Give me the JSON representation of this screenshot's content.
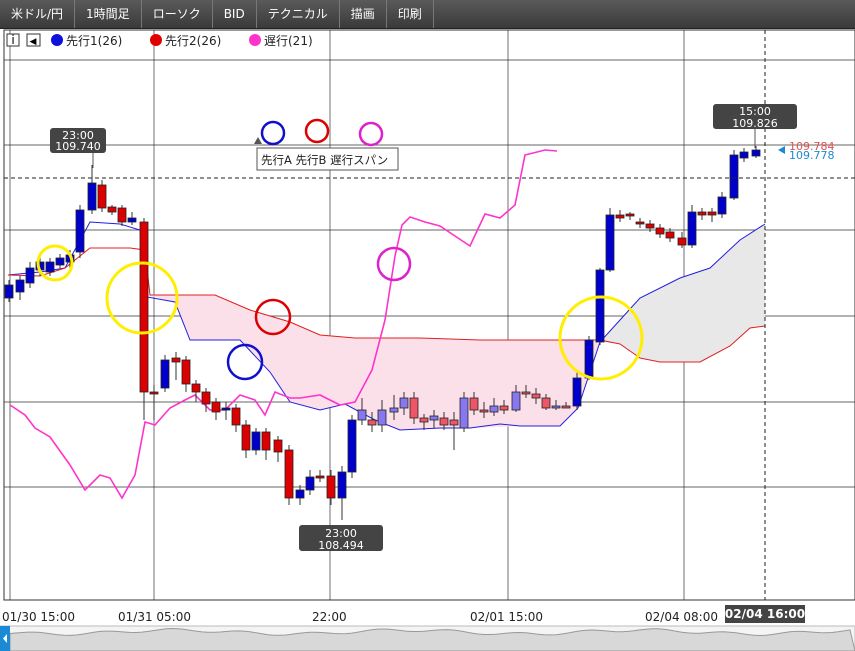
{
  "toolbar": {
    "items": [
      "米ドル/円",
      "1時間足",
      "ローソク",
      "BID",
      "テクニカル",
      "描画",
      "印刷"
    ]
  },
  "legend": {
    "info_icon": "i",
    "collapse_icon": "◀",
    "items": [
      {
        "label": "先行1(26)",
        "color": "#1010dd"
      },
      {
        "label": "先行2(26)",
        "color": "#e00000"
      },
      {
        "label": "遅行(21)",
        "color": "#ff33cc"
      }
    ]
  },
  "annotation": {
    "label": "先行A 先行B 遅行スパン",
    "circle_colors": [
      "#1010cc",
      "#dd0000",
      "#dd22cc"
    ]
  },
  "tooltips": {
    "high": {
      "time": "23:00",
      "value": "109.740"
    },
    "low": {
      "time": "23:00",
      "value": "108.494"
    },
    "last": {
      "time": "15:00",
      "value": "109.826"
    }
  },
  "price_labels": {
    "red": "109.784",
    "blue": "109.778"
  },
  "x_axis": {
    "labels": [
      "01/30 15:00",
      "01/31 05:00",
      "22:00",
      "02/01 15:00",
      "02/04 08:00"
    ],
    "current": "02/04 16:00"
  },
  "colors": {
    "up_candle": "#0000cc",
    "down_candle": "#dd0000",
    "cloud_bull": "#e8e8e8",
    "cloud_bear": "#fbe0ea",
    "highlight": "#ffee00"
  },
  "chart_data": {
    "type": "candlestick",
    "series": [
      {
        "name": "先行1(26)"
      },
      {
        "name": "先行2(26)"
      },
      {
        "name": "遅行(21)"
      }
    ],
    "high": {
      "time": "23:00",
      "value": 109.74
    },
    "low": {
      "time": "23:00",
      "value": 108.494
    },
    "last": {
      "time": "15:00",
      "value": 109.826
    },
    "x_labels": [
      "01/30 15:00",
      "01/31 05:00",
      "22:00",
      "02/01 15:00",
      "02/04 08:00",
      "02/04 16:00"
    ]
  }
}
